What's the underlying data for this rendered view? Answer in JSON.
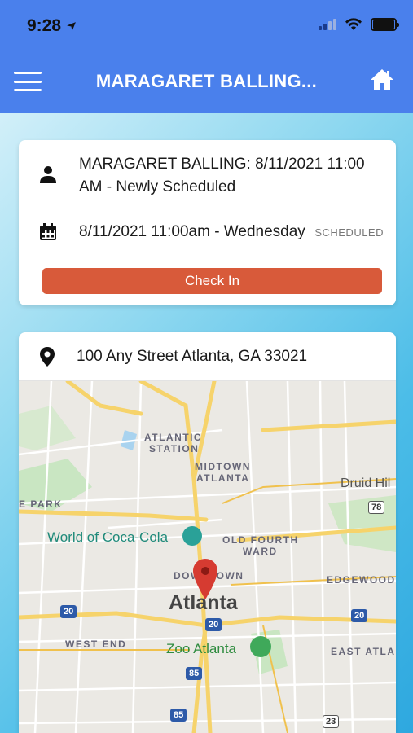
{
  "status_bar": {
    "time": "9:28"
  },
  "nav": {
    "title": "MARAGARET BALLING..."
  },
  "appointment": {
    "summary": "MARAGARET BALLING: 8/11/2021 11:00 AM - Newly Scheduled",
    "datetime": "8/11/2021 11:00am - Wednesday",
    "status": "SCHEDULED",
    "checkin_label": "Check In"
  },
  "location": {
    "address": "100 Any Street Atlanta, GA 33021"
  },
  "map": {
    "labels": {
      "atlantic": "ATLANTIC",
      "station": "STATION",
      "midtown": "MIDTOWN",
      "atlanta_small": "ATLANTA",
      "druid_hills": "Druid Hil",
      "park": "E PARK",
      "coca_cola": "World of Coca-Cola",
      "old_fourth": "OLD FOURTH",
      "ward": "WARD",
      "downtown": "DOWNTOWN",
      "edgewood": "EDGEWOOD",
      "atlanta": "Atlanta",
      "west_end": "WEST END",
      "zoo": "Zoo Atlanta",
      "east_atlanta": "EAST ATLA"
    },
    "shields": {
      "s78": "78",
      "s20a": "20",
      "s20b": "20",
      "s20c": "20",
      "s85a": "85",
      "s85b": "85",
      "s23": "23"
    }
  },
  "colors": {
    "header": "#4a80ec",
    "checkin": "#d85a3a",
    "pin": "#d63b31"
  }
}
